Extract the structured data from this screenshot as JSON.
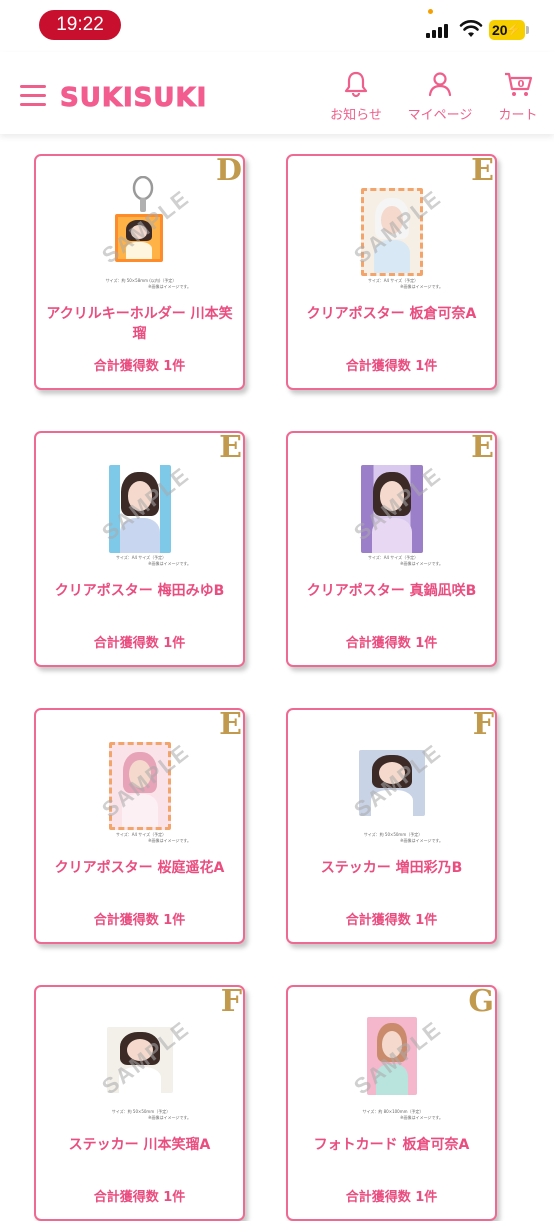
{
  "status": {
    "time": "19:22",
    "battery": "20"
  },
  "header": {
    "logo": "SUKISUKI",
    "cart_count": "0",
    "nav": [
      {
        "label": "お知らせ",
        "icon": "bell-icon"
      },
      {
        "label": "マイページ",
        "icon": "person-icon"
      },
      {
        "label": "カート",
        "icon": "cart-icon"
      }
    ]
  },
  "colors": {
    "accent": "#ef5f8c",
    "rank": "#c29a4e",
    "status_pill": "#c8102e"
  },
  "watermark": "SAMPLE",
  "cards": [
    {
      "rank": "D",
      "title": "アクリルキーホルダー 川本笑瑠",
      "count": "合計獲得数 1件",
      "caption": "サイズ：約 50×58mm (以内)（予定）",
      "note": "※画像はイメージです。"
    },
    {
      "rank": "E",
      "title": "クリアポスター 板倉可奈A",
      "count": "合計獲得数 1件",
      "caption": "サイズ：A4 サイズ（予定）",
      "note": "※画像はイメージです。"
    },
    {
      "rank": "E",
      "title": "クリアポスター 梅田みゆB",
      "count": "合計獲得数 1件",
      "caption": "サイズ：A4 サイズ（予定）",
      "note": "※画像はイメージです。"
    },
    {
      "rank": "E",
      "title": "クリアポスター 真鍋凪咲B",
      "count": "合計獲得数 1件",
      "caption": "サイズ：A4 サイズ（予定）",
      "note": "※画像はイメージです。"
    },
    {
      "rank": "E",
      "title": "クリアポスター 桜庭遥花A",
      "count": "合計獲得数 1件",
      "caption": "サイズ：A4 サイズ（予定）",
      "note": "※画像はイメージです。"
    },
    {
      "rank": "F",
      "title": "ステッカー 増田彩乃B",
      "count": "合計獲得数 1件",
      "caption": "サイズ：約 50×50mm（予定）",
      "note": "※画像はイメージです。"
    },
    {
      "rank": "F",
      "title": "ステッカー 川本笑瑠A",
      "count": "合計獲得数 1件",
      "caption": "サイズ：約 50×50mm（予定）",
      "note": "※画像はイメージです。"
    },
    {
      "rank": "G",
      "title": "フォトカード 板倉可奈A",
      "count": "合計獲得数 1件",
      "caption": "サイズ：約 80×100mm（予定）",
      "note": "※画像はイメージです。"
    }
  ]
}
